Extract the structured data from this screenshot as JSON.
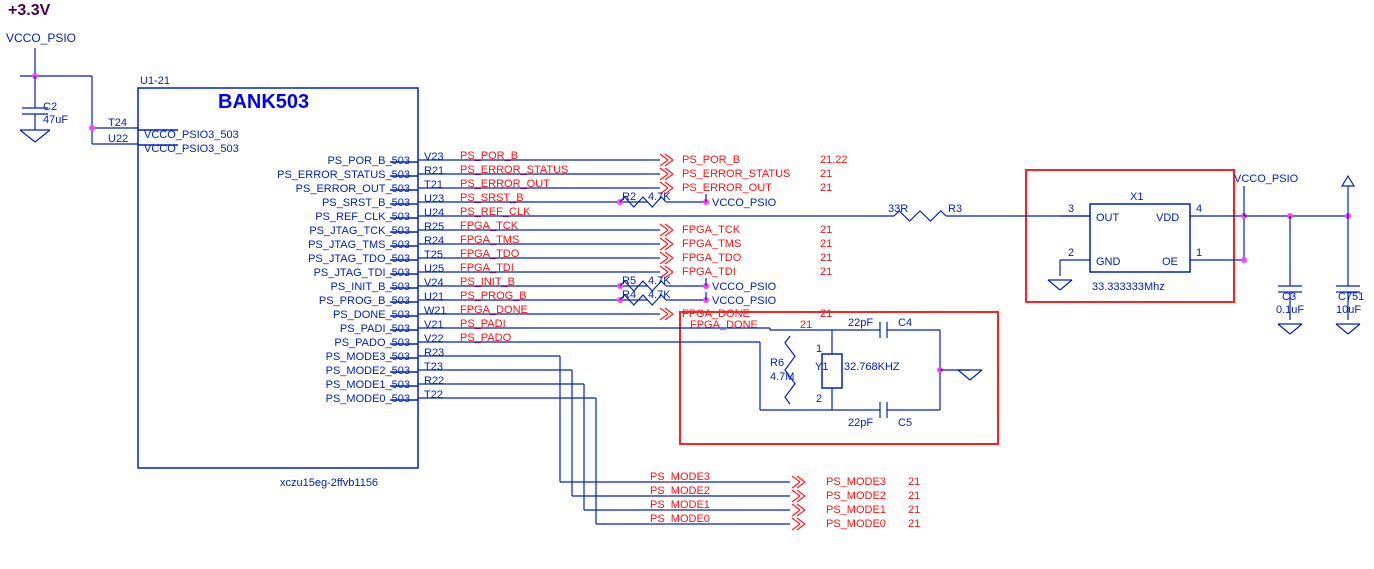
{
  "voltage_label": "+3.3V",
  "voltage_netname": "VCCO_PSIO",
  "main_ic": {
    "refdes": "U1-21",
    "title": "BANK503",
    "power_pins": [
      {
        "pin": "T24",
        "name": "VCCO_PSIO3_503"
      },
      {
        "pin": "U22",
        "name": "VCCO_PSIO3_503"
      }
    ],
    "signal_pins": [
      {
        "pin": "V23",
        "name": "PS_POR_B_503",
        "net": "PS_POR_B"
      },
      {
        "pin": "R21",
        "name": "PS_ERROR_STATUS_503",
        "net": "PS_ERROR_STATUS"
      },
      {
        "pin": "T21",
        "name": "PS_ERROR_OUT_503",
        "net": "PS_ERROR_OUT"
      },
      {
        "pin": "U23",
        "name": "PS_SRST_B_503",
        "net": "PS_SRST_B"
      },
      {
        "pin": "U24",
        "name": "PS_REF_CLK_503",
        "net": "PS_REF_CLK"
      },
      {
        "pin": "R25",
        "name": "FPGA_TCK",
        "net": "PS_JTAG_TCK_503",
        "flip": true
      },
      {
        "pin": "R24",
        "name": "FPGA_TMS",
        "net": "PS_JTAG_TMS_503",
        "flip": true
      },
      {
        "pin": "T25",
        "name": "FPGA_TDO",
        "net": "PS_JTAG_TDO_503",
        "flip": true
      },
      {
        "pin": "U25",
        "name": "FPGA_TDI",
        "net": "PS_JTAG_TDI_503",
        "flip": true
      },
      {
        "pin": "V24",
        "name": "PS_INIT_B_503",
        "net": "PS_INIT_B"
      },
      {
        "pin": "U21",
        "name": "PS_PROG_B_503",
        "net": "PS_PROG_B"
      },
      {
        "pin": "W21",
        "name": "PS_DONE_503",
        "net": "FPGA_DONE"
      },
      {
        "pin": "V21",
        "name": "PS_PADI_503",
        "net": "PS_PADI"
      },
      {
        "pin": "V22",
        "name": "PS_PADO_503",
        "net": "PS_PADO"
      },
      {
        "pin": "R23",
        "name": "PS_MODE3_503",
        "net": ""
      },
      {
        "pin": "T23",
        "name": "PS_MODE2_503",
        "net": ""
      },
      {
        "pin": "R22",
        "name": "PS_MODE1_503",
        "net": ""
      },
      {
        "pin": "T22",
        "name": "PS_MODE0_503",
        "net": ""
      }
    ],
    "partnum": "xczu15eg-2ffvb1156"
  },
  "power_cap": {
    "ref": "C2",
    "val": "47uF"
  },
  "pullups": [
    {
      "ref": "R2",
      "val": "4.7K"
    },
    {
      "ref": "R5",
      "val": "4.7K"
    },
    {
      "ref": "R4",
      "val": "4.7K"
    }
  ],
  "signal_refs": [
    {
      "net": "PS_POR_B",
      "pages": "21,22"
    },
    {
      "net": "PS_ERROR_STATUS",
      "pages": "21"
    },
    {
      "net": "PS_ERROR_OUT",
      "pages": "21"
    },
    {
      "net": "FPGA_TCK",
      "pages": "21"
    },
    {
      "net": "FPGA_TMS",
      "pages": "21"
    },
    {
      "net": "FPGA_TDO",
      "pages": "21"
    },
    {
      "net": "FPGA_TDI",
      "pages": "21"
    },
    {
      "net": "FPGA_DONE",
      "pages": "21"
    }
  ],
  "mode_refs": [
    {
      "net": "PS_MODE3",
      "far_net": "PS_MODE3",
      "pages": "21"
    },
    {
      "net": "PS_MODE2",
      "far_net": "PS_MODE2",
      "pages": "21"
    },
    {
      "net": "PS_MODE1",
      "far_net": "PS_MODE1",
      "pages": "21"
    },
    {
      "net": "PS_MODE0",
      "far_net": "PS_MODE0",
      "pages": "21"
    }
  ],
  "pullup_net": "VCCO_PSIO",
  "crystal": {
    "ref": "Y1",
    "val": "32.768KHZ",
    "r_ref": "R6",
    "r_val": "4.7M",
    "c_top": {
      "ref": "C4",
      "val": "22pF"
    },
    "c_bot": {
      "ref": "C5",
      "val": "22pF"
    },
    "pin_top": "1",
    "pin_bot": "2"
  },
  "osc": {
    "refdes": "X1",
    "val": "33.333333Mhz",
    "pins": {
      "out": "3",
      "gnd": "2",
      "vdd": "4",
      "oe": "1"
    },
    "r_ref": "R3",
    "r_val": "33R",
    "power_net": "VCCO_PSIO",
    "caps": [
      {
        "ref": "C3",
        "val": "0.1uF"
      },
      {
        "ref": "C751",
        "val": "10uF"
      }
    ]
  }
}
